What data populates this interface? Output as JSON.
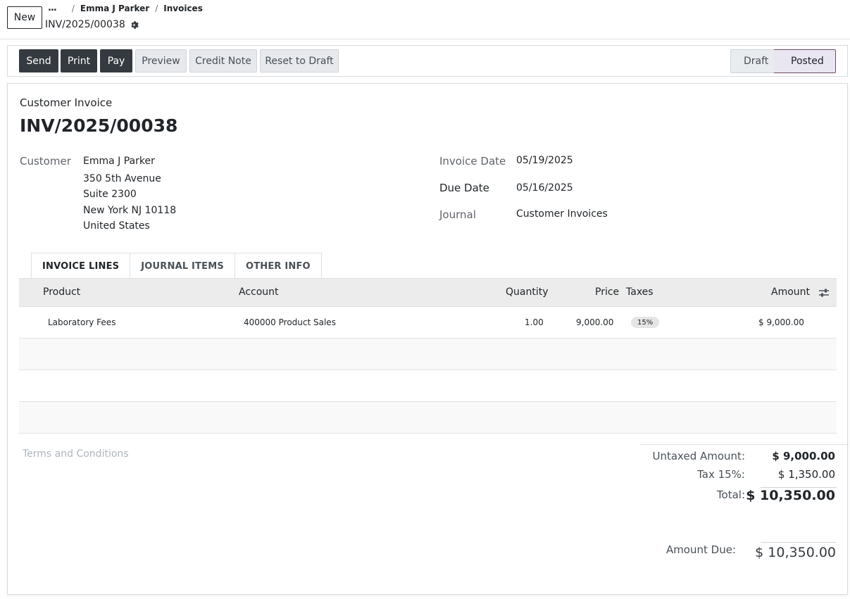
{
  "header": {
    "new_label": "New",
    "breadcrumb": {
      "ellipsis": "...",
      "sep": "/",
      "customer": "Emma J Parker",
      "invoices": "Invoices"
    },
    "record_name": "INV/2025/00038"
  },
  "statusbar": {
    "buttons": [
      "Send",
      "Print",
      "Pay",
      "Preview",
      "Credit Note",
      "Reset to Draft"
    ],
    "stages": {
      "draft": "Draft",
      "posted": "Posted"
    },
    "active_stage": "Posted"
  },
  "invoice": {
    "doc_type": "Customer Invoice",
    "number": "INV/2025/00038",
    "customer_label": "Customer",
    "customer_name": "Emma J Parker",
    "address": [
      "350 5th Avenue",
      "Suite 2300",
      "New York NJ 10118",
      "United States"
    ],
    "invoice_date_label": "Invoice Date",
    "invoice_date": "05/19/2025",
    "due_date_label": "Due Date",
    "due_date": "05/16/2025",
    "journal_label": "Journal",
    "journal": "Customer Invoices"
  },
  "tabs": [
    "INVOICE LINES",
    "JOURNAL ITEMS",
    "OTHER INFO"
  ],
  "table": {
    "columns": {
      "product": "Product",
      "account": "Account",
      "quantity": "Quantity",
      "price": "Price",
      "taxes": "Taxes",
      "amount": "Amount"
    },
    "rows": [
      {
        "product": "Laboratory Fees",
        "account": "400000 Product Sales",
        "quantity": "1.00",
        "price": "9,000.00",
        "tax": "15%",
        "amount": "$ 9,000.00"
      }
    ]
  },
  "terms_placeholder": "Terms and Conditions",
  "totals": {
    "untaxed_label": "Untaxed Amount:",
    "untaxed": "$ 9,000.00",
    "tax_label": "Tax 15%:",
    "tax": "$ 1,350.00",
    "total_label": "Total:",
    "total": "$ 10,350.00",
    "amount_due_label": "Amount Due:",
    "amount_due": "$ 10,350.00"
  },
  "colors": {
    "dark_button": "#343a40",
    "posted_stage": "#714b67"
  }
}
